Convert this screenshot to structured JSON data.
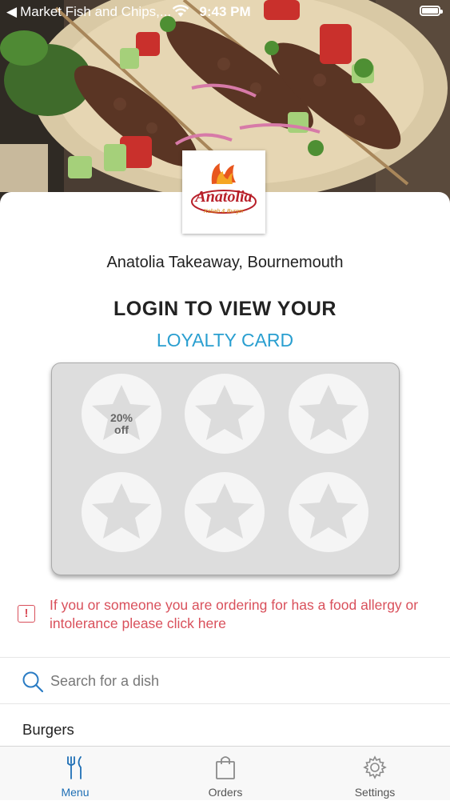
{
  "status_bar": {
    "back_app": "Market Fish and Chips,...",
    "time": "9:43 PM"
  },
  "restaurant": {
    "name": "Anatolia Takeaway, Bournemouth",
    "logo_text": "Anatolia",
    "logo_subtext": "Kebab & Burger"
  },
  "loyalty": {
    "title": "LOGIN TO VIEW YOUR",
    "subtitle": "LOYALTY CARD",
    "stamps_total": 6,
    "reward_line1": "20%",
    "reward_line2": "off"
  },
  "allergy": {
    "icon": "exclamation-icon",
    "text": "If you or someone you are ordering for has a food allergy or intolerance please click here"
  },
  "search": {
    "placeholder": "Search for a dish"
  },
  "menu": {
    "first_category": "Burgers"
  },
  "tabs": [
    {
      "label": "Menu",
      "icon": "fork-knife-icon",
      "active": true
    },
    {
      "label": "Orders",
      "icon": "shopping-bag-icon",
      "active": false
    },
    {
      "label": "Settings",
      "icon": "gear-icon",
      "active": false
    }
  ],
  "colors": {
    "accent_blue": "#2a9fd0",
    "active_tab": "#1f6fb5",
    "allergy_red": "#d9505b"
  }
}
